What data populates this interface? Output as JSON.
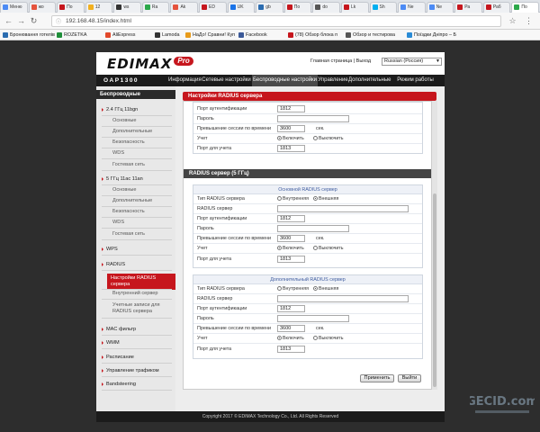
{
  "browser": {
    "tabs": [
      "Меню",
      "жо",
      "По",
      "12",
      "ws",
      "Ra",
      "Ak",
      "ED",
      "UK",
      "gb",
      "По",
      "do",
      "Lk",
      "Sh",
      "Ne",
      "Ne",
      "Ра",
      "Раб",
      "По"
    ],
    "active_tab": 18,
    "url": "192.168.48.15/index.html",
    "bookmarks": [
      "Бронювання готелів",
      "ROZETKA",
      "AliExpress",
      "Lamoda",
      "НаДо! Сравни! Куп",
      "Facebook",
      "(78) Обзор блока п",
      "Обзор и тестирова",
      "Поїздки Дніпро – Б"
    ],
    "bookmark_colors": [
      "#2b6cb0",
      "#1f8f3a",
      "#e2492b",
      "#333333",
      "#e89b1a",
      "#3b5998",
      "#c6161d",
      "#555555",
      "#2a8bd6"
    ]
  },
  "header": {
    "brand": "EDIMAX",
    "brand_suffix": "Pro",
    "home_link": "Главная страница",
    "separator": "|",
    "logout_link": "Выход",
    "language": "Russian (Россия)"
  },
  "model": "OAP1300",
  "nav": [
    "Информация",
    "Сетевые настройки",
    "Беспроводные настройки",
    "Управление",
    "Дополнительные",
    "Режим работы"
  ],
  "nav_selected": 2,
  "sidebar": {
    "title": "Беспроводные",
    "items": [
      {
        "label": "2.4 ГГц 11bgn",
        "type": "group"
      },
      {
        "label": "Основные",
        "type": "sub"
      },
      {
        "label": "Дополнительные",
        "type": "sub"
      },
      {
        "label": "Безопасность",
        "type": "sub"
      },
      {
        "label": "WDS",
        "type": "sub"
      },
      {
        "label": "Гостевая сеть",
        "type": "sub"
      },
      {
        "label": "5 ГГц 11ac 11an",
        "type": "group"
      },
      {
        "label": "Основные",
        "type": "sub"
      },
      {
        "label": "Дополнительные",
        "type": "sub"
      },
      {
        "label": "Безопасность",
        "type": "sub"
      },
      {
        "label": "WDS",
        "type": "sub"
      },
      {
        "label": "Гостевая сеть",
        "type": "sub"
      },
      {
        "label": "WPS",
        "type": "group"
      },
      {
        "label": "RADIUS",
        "type": "group"
      },
      {
        "label": "Настройки RADIUS сервера",
        "type": "active"
      },
      {
        "label": "Внутренний сервер",
        "type": "sub"
      },
      {
        "label": "Учетные записи для RADIUS сервера",
        "type": "sub"
      },
      {
        "label": "MAC фильтр",
        "type": "group"
      },
      {
        "label": "WMM",
        "type": "group"
      },
      {
        "label": "Расписание",
        "type": "group"
      },
      {
        "label": "Управление трафиком",
        "type": "group"
      },
      {
        "label": "Bandsteering",
        "type": "group"
      }
    ]
  },
  "content": {
    "title": "Настройки RADIUS сервера",
    "top_rows": {
      "auth_port_label": "Порт аутентификации",
      "auth_port": "1812",
      "password_label": "Пароль",
      "session_timeout_label": "Превышение сессии по времени",
      "session_timeout": "3600",
      "unit_sec": "сек.",
      "accounting_label": "Учет",
      "enable_label": "Включить",
      "disable_label": "Выключить",
      "acct_port_label": "Порт для учета",
      "acct_port": "1813"
    },
    "section_5g": "RADIUS сервер (5 ГГц)",
    "primary": {
      "heading": "Основной RADIUS сервер",
      "type_label": "Тип RADIUS сервера",
      "internal": "Внутренняя",
      "external": "Внешняя",
      "server_label": "RADIUS сервер",
      "auth_port_label": "Порт аутентификации",
      "auth_port": "1812",
      "password_label": "Пароль",
      "session_timeout_label": "Превышение сессии по времени",
      "session_timeout": "3600",
      "unit_sec": "сек.",
      "accounting_label": "Учет",
      "enable_label": "Включить",
      "disable_label": "Выключить",
      "acct_port_label": "Порт для учета",
      "acct_port": "1813"
    },
    "secondary": {
      "heading": "Дополнительный RADIUS сервер",
      "type_label": "Тип RADIUS сервера",
      "internal": "Внутренняя",
      "external": "Внешняя",
      "server_label": "RADIUS сервер",
      "auth_port_label": "Порт аутентификации",
      "auth_port": "1812",
      "password_label": "Пароль",
      "session_timeout_label": "Превышение сессии по времени",
      "session_timeout": "3600",
      "unit_sec": "сек.",
      "accounting_label": "Учет",
      "enable_label": "Включить",
      "disable_label": "Выключить",
      "acct_port_label": "Порт для учета",
      "acct_port": "1813"
    },
    "apply_button": "Применить",
    "cancel_button": "Выйти"
  },
  "footer": "Copyright 2017 © EDIMAX Technology Co., Ltd. All Rights Reserved",
  "watermark": "GECID.com",
  "colors": {
    "accent": "#c6161d",
    "dark_bar": "#1b1b1b",
    "subhead_text": "#3f5c9f"
  }
}
